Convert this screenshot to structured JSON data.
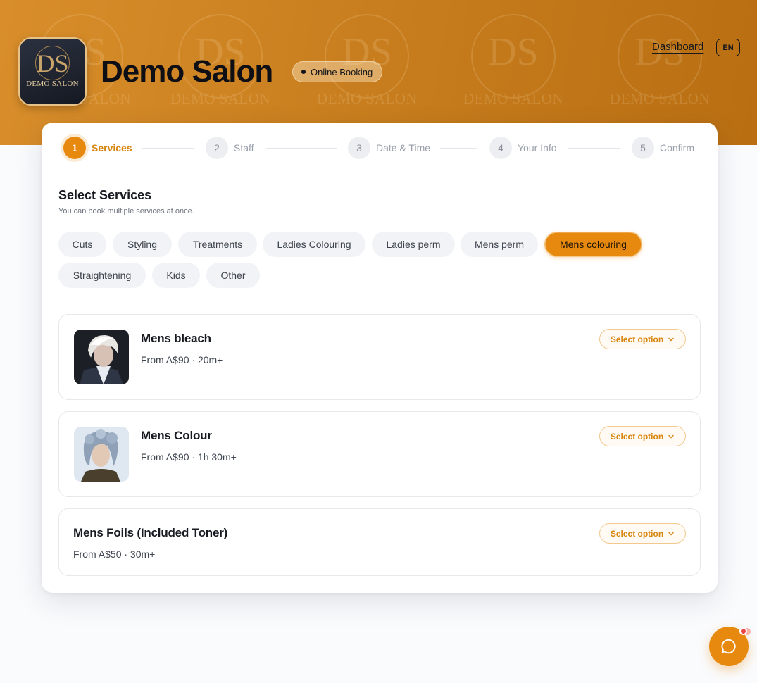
{
  "header": {
    "logo_monogram": "DS",
    "logo_text": "DEMO SALON",
    "brand_name": "Demo Salon",
    "booking_badge": "Online Booking",
    "dashboard_link": "Dashboard",
    "language": "EN"
  },
  "steps": [
    {
      "num": "1",
      "label": "Services"
    },
    {
      "num": "2",
      "label": "Staff"
    },
    {
      "num": "3",
      "label": "Date & Time"
    },
    {
      "num": "4",
      "label": "Your Info"
    },
    {
      "num": "5",
      "label": "Confirm"
    }
  ],
  "active_step": "Services",
  "section": {
    "title": "Select Services",
    "subtitle": "You can book multiple services at once."
  },
  "categories": [
    "Cuts",
    "Styling",
    "Treatments",
    "Ladies Colouring",
    "Ladies perm",
    "Mens perm",
    "Mens colouring",
    "Straightening",
    "Kids",
    "Other"
  ],
  "active_category": "Mens colouring",
  "services": [
    {
      "name": "Mens bleach",
      "meta": "From A$90 · 20m+",
      "button": "Select option"
    },
    {
      "name": "Mens Colour",
      "meta": "From A$90 · 1h 30m+",
      "button": "Select option"
    },
    {
      "name": "Mens Foils (Included Toner)",
      "meta": "From A$50 · 30m+",
      "button": "Select option"
    }
  ],
  "colors": {
    "accent": "#e8890f",
    "hero_start": "#d98e2b",
    "hero_end": "#b96e12"
  },
  "icons": {
    "chat": "chat-bubble-icon",
    "dropdown": "chevron-down-icon"
  }
}
